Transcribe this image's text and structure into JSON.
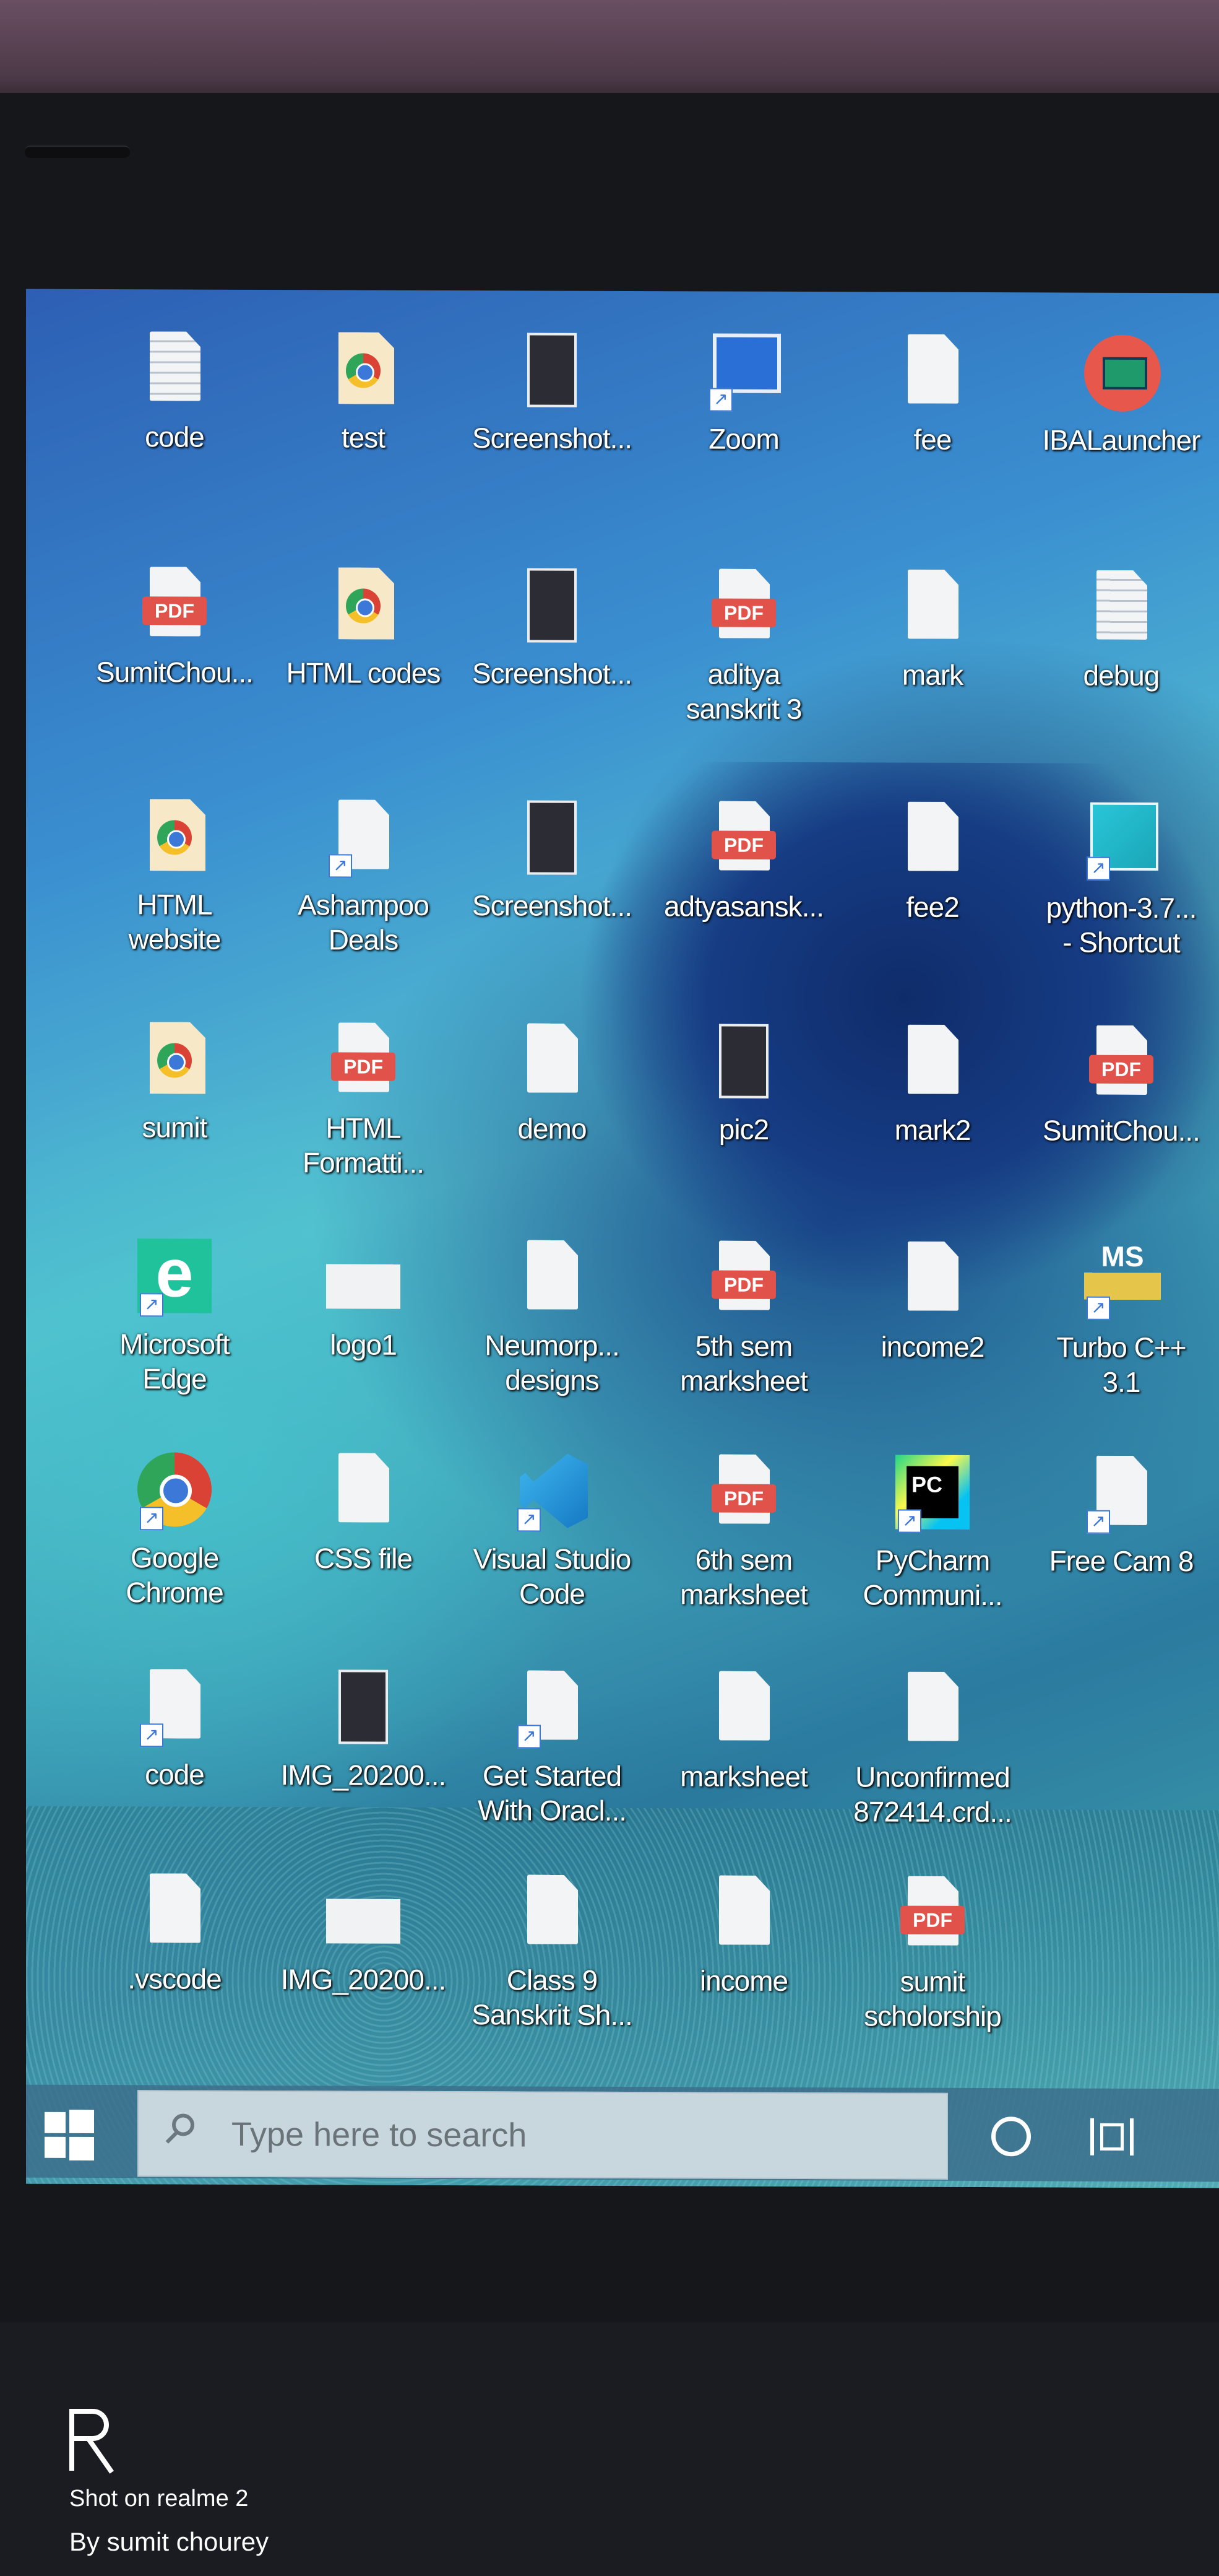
{
  "desktop_icons": [
    {
      "label": "code",
      "kind": "text-file"
    },
    {
      "label": "test",
      "kind": "chrome-html"
    },
    {
      "label": "Screenshot...",
      "kind": "image"
    },
    {
      "label": "Zoom",
      "kind": "zoom-shortcut"
    },
    {
      "label": "fee",
      "kind": "file"
    },
    {
      "label": "IBALauncher",
      "kind": "iba-app"
    },
    {
      "label": "SumitChou...",
      "kind": "pdf"
    },
    {
      "label": "HTML codes",
      "kind": "chrome-html"
    },
    {
      "label": "Screenshot...",
      "kind": "image"
    },
    {
      "label": "aditya\nsanskrit 3",
      "kind": "pdf"
    },
    {
      "label": "mark",
      "kind": "file"
    },
    {
      "label": "debug",
      "kind": "text-file"
    },
    {
      "label": "HTML\nwebsite",
      "kind": "chrome-html"
    },
    {
      "label": "Ashampoo\nDeals",
      "kind": "shortcut-file"
    },
    {
      "label": "Screenshot...",
      "kind": "image"
    },
    {
      "label": "adtyasansk...",
      "kind": "pdf"
    },
    {
      "label": "fee2",
      "kind": "file"
    },
    {
      "label": "python-3.7...\n- Shortcut",
      "kind": "python-shortcut"
    },
    {
      "label": "sumit",
      "kind": "chrome-html"
    },
    {
      "label": "HTML\nFormatti...",
      "kind": "pdf"
    },
    {
      "label": "demo",
      "kind": "file"
    },
    {
      "label": "pic2",
      "kind": "photo"
    },
    {
      "label": "mark2",
      "kind": "file"
    },
    {
      "label": "SumitChou...",
      "kind": "pdf"
    },
    {
      "label": "Microsoft\nEdge",
      "kind": "edge"
    },
    {
      "label": "logo1",
      "kind": "image-strip"
    },
    {
      "label": "Neumorp...\ndesigns",
      "kind": "file"
    },
    {
      "label": "5th sem\nmarksheet",
      "kind": "pdf"
    },
    {
      "label": "income2",
      "kind": "file"
    },
    {
      "label": "Turbo C++\n3.1",
      "kind": "turbo"
    },
    {
      "label": "Google\nChrome",
      "kind": "chrome"
    },
    {
      "label": "CSS file",
      "kind": "file"
    },
    {
      "label": "Visual Studio\nCode",
      "kind": "vscode"
    },
    {
      "label": "6th sem\nmarksheet",
      "kind": "pdf"
    },
    {
      "label": "PyCharm\nCommuni...",
      "kind": "pycharm"
    },
    {
      "label": "Free Cam 8",
      "kind": "shortcut-file"
    },
    {
      "label": "code",
      "kind": "shortcut-file"
    },
    {
      "label": "IMG_20200...",
      "kind": "photo"
    },
    {
      "label": "Get Started\nWith Oracl...",
      "kind": "shortcut-file"
    },
    {
      "label": "marksheet",
      "kind": "file"
    },
    {
      "label": "Unconfirmed\n872414.crd...",
      "kind": "file"
    },
    {
      "label": ".vscode",
      "kind": "file"
    },
    {
      "label": "IMG_20200...",
      "kind": "image-strip"
    },
    {
      "label": "Class 9\nSanskrit Sh...",
      "kind": "file"
    },
    {
      "label": "income",
      "kind": "file"
    },
    {
      "label": "sumit\nscholorship",
      "kind": "pdf"
    }
  ],
  "pdf_tag_text": "PDF",
  "turbo_badge_text": "MS",
  "pycharm_badge_text": "PC",
  "edge_glyph": "e",
  "taskbar": {
    "search_placeholder": "Type here to search",
    "start_icon": "windows-logo-icon",
    "cortana_icon": "cortana-circle-icon",
    "taskview_icon": "task-view-icon"
  },
  "watermark": {
    "line1": "Shot on realme 2",
    "line2": "By sumit chourey"
  }
}
